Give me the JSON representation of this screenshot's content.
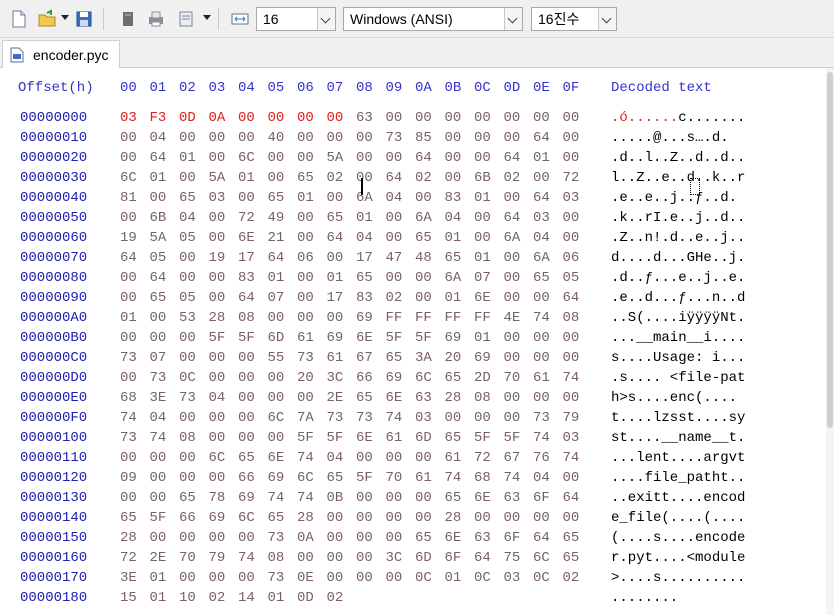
{
  "toolbar": {
    "icons": [
      "new-file-icon",
      "open-folder-icon",
      "save-icon",
      "cut-icon",
      "print-icon",
      "print-preview-icon",
      "columns-icon"
    ],
    "bytes_per_row": "16",
    "encoding": "Windows (ANSI)",
    "number_format": "16진수"
  },
  "tab": {
    "label": "encoder.pyc",
    "icon": "pyc-file-icon"
  },
  "hex": {
    "offset_header": "Offset(h)",
    "column_headers": [
      "00",
      "01",
      "02",
      "03",
      "04",
      "05",
      "06",
      "07",
      "08",
      "09",
      "0A",
      "0B",
      "0C",
      "0D",
      "0E",
      "0F"
    ],
    "decoded_header": "Decoded text",
    "rows": [
      {
        "offset": "00000000",
        "bytes": [
          "03",
          "F3",
          "0D",
          "0A",
          "00",
          "00",
          "00",
          "00",
          "63",
          "00",
          "00",
          "00",
          "00",
          "00",
          "00",
          "00"
        ],
        "text": ".ó......c......."
      },
      {
        "offset": "00000010",
        "bytes": [
          "00",
          "04",
          "00",
          "00",
          "00",
          "40",
          "00",
          "00",
          "00",
          "73",
          "85",
          "00",
          "00",
          "00",
          "64",
          "00"
        ],
        "text": ".....@...s….d."
      },
      {
        "offset": "00000020",
        "bytes": [
          "00",
          "64",
          "01",
          "00",
          "6C",
          "00",
          "00",
          "5A",
          "00",
          "00",
          "64",
          "00",
          "00",
          "64",
          "01",
          "00"
        ],
        "text": ".d..l..Z..d..d.."
      },
      {
        "offset": "00000030",
        "bytes": [
          "6C",
          "01",
          "00",
          "5A",
          "01",
          "00",
          "65",
          "02",
          "00",
          "64",
          "02",
          "00",
          "6B",
          "02",
          "00",
          "72"
        ],
        "text": "l..Z..e..d..k..r"
      },
      {
        "offset": "00000040",
        "bytes": [
          "81",
          "00",
          "65",
          "03",
          "00",
          "65",
          "01",
          "00",
          "6A",
          "04",
          "00",
          "83",
          "01",
          "00",
          "64",
          "03"
        ],
        "text": ".e..e..j..ƒ..d."
      },
      {
        "offset": "00000050",
        "bytes": [
          "00",
          "6B",
          "04",
          "00",
          "72",
          "49",
          "00",
          "65",
          "01",
          "00",
          "6A",
          "04",
          "00",
          "64",
          "03",
          "00"
        ],
        "text": ".k..rI.e..j..d.."
      },
      {
        "offset": "00000060",
        "bytes": [
          "19",
          "5A",
          "05",
          "00",
          "6E",
          "21",
          "00",
          "64",
          "04",
          "00",
          "65",
          "01",
          "00",
          "6A",
          "04",
          "00"
        ],
        "text": ".Z..n!.d..e..j.."
      },
      {
        "offset": "00000070",
        "bytes": [
          "64",
          "05",
          "00",
          "19",
          "17",
          "64",
          "06",
          "00",
          "17",
          "47",
          "48",
          "65",
          "01",
          "00",
          "6A",
          "06"
        ],
        "text": "d....d...GHe..j."
      },
      {
        "offset": "00000080",
        "bytes": [
          "00",
          "64",
          "00",
          "00",
          "83",
          "01",
          "00",
          "01",
          "65",
          "00",
          "00",
          "6A",
          "07",
          "00",
          "65",
          "05"
        ],
        "text": ".d..ƒ...e..j..e."
      },
      {
        "offset": "00000090",
        "bytes": [
          "00",
          "65",
          "05",
          "00",
          "64",
          "07",
          "00",
          "17",
          "83",
          "02",
          "00",
          "01",
          "6E",
          "00",
          "00",
          "64"
        ],
        "text": ".e..d...ƒ...n..d"
      },
      {
        "offset": "000000A0",
        "bytes": [
          "01",
          "00",
          "53",
          "28",
          "08",
          "00",
          "00",
          "00",
          "69",
          "FF",
          "FF",
          "FF",
          "FF",
          "4E",
          "74",
          "08"
        ],
        "text": "..S(....iÿÿÿÿNt."
      },
      {
        "offset": "000000B0",
        "bytes": [
          "00",
          "00",
          "00",
          "5F",
          "5F",
          "6D",
          "61",
          "69",
          "6E",
          "5F",
          "5F",
          "69",
          "01",
          "00",
          "00",
          "00"
        ],
        "text": "...__main__i...."
      },
      {
        "offset": "000000C0",
        "bytes": [
          "73",
          "07",
          "00",
          "00",
          "00",
          "55",
          "73",
          "61",
          "67",
          "65",
          "3A",
          "20",
          "69",
          "00",
          "00",
          "00"
        ],
        "text": "s....Usage: i..."
      },
      {
        "offset": "000000D0",
        "bytes": [
          "00",
          "73",
          "0C",
          "00",
          "00",
          "00",
          "20",
          "3C",
          "66",
          "69",
          "6C",
          "65",
          "2D",
          "70",
          "61",
          "74"
        ],
        "text": ".s.... <file-pat"
      },
      {
        "offset": "000000E0",
        "bytes": [
          "68",
          "3E",
          "73",
          "04",
          "00",
          "00",
          "00",
          "2E",
          "65",
          "6E",
          "63",
          "28",
          "08",
          "00",
          "00",
          "00"
        ],
        "text": "h>s....enc(...."
      },
      {
        "offset": "000000F0",
        "bytes": [
          "74",
          "04",
          "00",
          "00",
          "00",
          "6C",
          "7A",
          "73",
          "73",
          "74",
          "03",
          "00",
          "00",
          "00",
          "73",
          "79"
        ],
        "text": "t....lzsst....sy"
      },
      {
        "offset": "00000100",
        "bytes": [
          "73",
          "74",
          "08",
          "00",
          "00",
          "00",
          "5F",
          "5F",
          "6E",
          "61",
          "6D",
          "65",
          "5F",
          "5F",
          "74",
          "03"
        ],
        "text": "st....__name__t."
      },
      {
        "offset": "00000110",
        "bytes": [
          "00",
          "00",
          "00",
          "6C",
          "65",
          "6E",
          "74",
          "04",
          "00",
          "00",
          "00",
          "61",
          "72",
          "67",
          "76",
          "74"
        ],
        "text": "...lent....argvt"
      },
      {
        "offset": "00000120",
        "bytes": [
          "09",
          "00",
          "00",
          "00",
          "66",
          "69",
          "6C",
          "65",
          "5F",
          "70",
          "61",
          "74",
          "68",
          "74",
          "04",
          "00"
        ],
        "text": "....file_patht.."
      },
      {
        "offset": "00000130",
        "bytes": [
          "00",
          "00",
          "65",
          "78",
          "69",
          "74",
          "74",
          "0B",
          "00",
          "00",
          "00",
          "65",
          "6E",
          "63",
          "6F",
          "64"
        ],
        "text": "..exitt....encod"
      },
      {
        "offset": "00000140",
        "bytes": [
          "65",
          "5F",
          "66",
          "69",
          "6C",
          "65",
          "28",
          "00",
          "00",
          "00",
          "00",
          "28",
          "00",
          "00",
          "00",
          "00"
        ],
        "text": "e_file(....(...."
      },
      {
        "offset": "00000150",
        "bytes": [
          "28",
          "00",
          "00",
          "00",
          "00",
          "73",
          "0A",
          "00",
          "00",
          "00",
          "65",
          "6E",
          "63",
          "6F",
          "64",
          "65"
        ],
        "text": "(....s....encode"
      },
      {
        "offset": "00000160",
        "bytes": [
          "72",
          "2E",
          "70",
          "79",
          "74",
          "08",
          "00",
          "00",
          "00",
          "3C",
          "6D",
          "6F",
          "64",
          "75",
          "6C",
          "65"
        ],
        "text": "r.pyt....<module"
      },
      {
        "offset": "00000170",
        "bytes": [
          "3E",
          "01",
          "00",
          "00",
          "00",
          "73",
          "0E",
          "00",
          "00",
          "00",
          "0C",
          "01",
          "0C",
          "03",
          "0C",
          "02"
        ],
        "text": ">....s.........."
      },
      {
        "offset": "00000180",
        "bytes": [
          "15",
          "01",
          "10",
          "02",
          "14",
          "01",
          "0D",
          "02"
        ],
        "text": "........"
      }
    ]
  },
  "colors": {
    "highlight": "#e02020",
    "offset": "#2020b0",
    "header": "#3333cc",
    "bytes": "#7a6262"
  }
}
